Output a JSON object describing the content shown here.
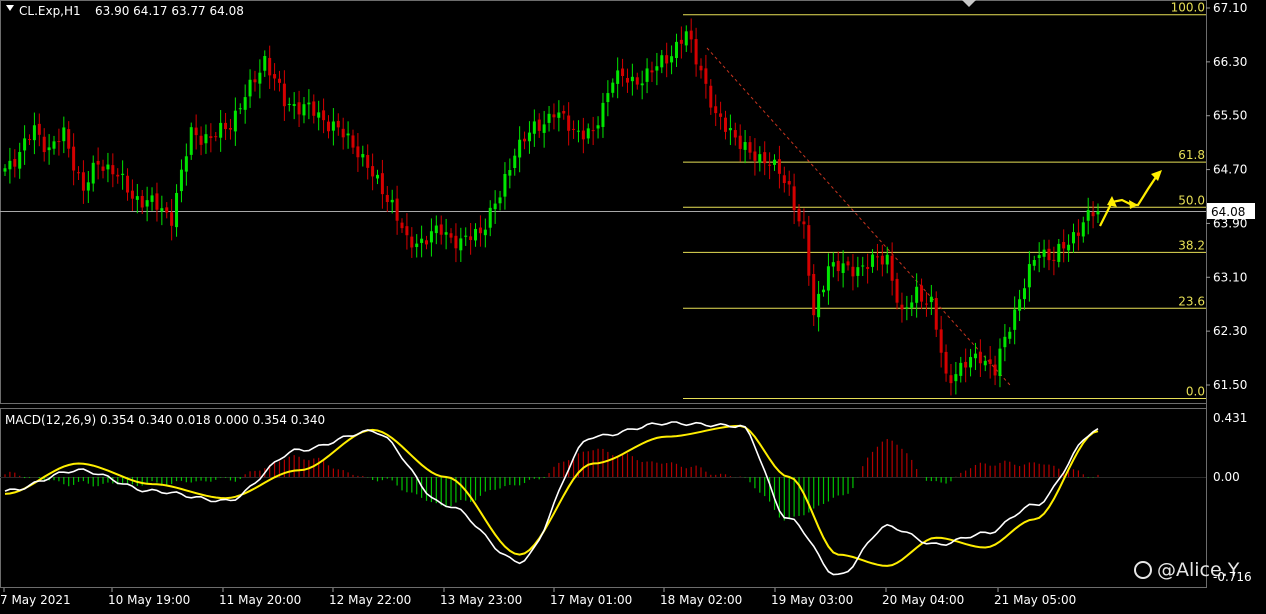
{
  "header": {
    "symbol_label": "CL.Exp,H1",
    "ohlc_label": "63.90 64.17 63.77 64.08"
  },
  "macd": {
    "label": "MACD(12,26,9) 0.354 0.340 0.018 0.000 0.354 0.340",
    "axis": [
      "0.431",
      "0.00",
      "-0.716"
    ]
  },
  "price_axis": [
    "67.10",
    "66.30",
    "65.50",
    "64.70",
    "63.90",
    "63.10",
    "62.30",
    "61.50"
  ],
  "current_price": "64.08",
  "fib_levels": [
    {
      "label": "100.0",
      "price": 67.0
    },
    {
      "label": "61.8",
      "price": 64.81
    },
    {
      "label": "50.0",
      "price": 64.14
    },
    {
      "label": "38.2",
      "price": 63.47
    },
    {
      "label": "23.6",
      "price": 62.64
    },
    {
      "label": "0.0",
      "price": 61.3
    }
  ],
  "time_axis": [
    "7 May 2021",
    "10 May 19:00",
    "11 May 20:00",
    "12 May 22:00",
    "13 May 23:00",
    "17 May 01:00",
    "18 May 02:00",
    "19 May 03:00",
    "20 May 04:00",
    "21 May 05:00"
  ],
  "watermark": "@Alice.Y",
  "colors": {
    "background": "#000000",
    "bull_candle": "#00e600",
    "bear_candle": "#d40000",
    "fib_line": "#e7df56",
    "macd_line": "#ffffff",
    "signal_line": "#ffee00",
    "arrow": "#ffee00",
    "trend_line": "#c8341f"
  },
  "chart_data": [
    {
      "type": "candlestick",
      "title": "CL.Exp,H1",
      "ylim": [
        61.27,
        67.18
      ],
      "close_key_points": [
        [
          0,
          64.72
        ],
        [
          3,
          64.95
        ],
        [
          6,
          65.3
        ],
        [
          9,
          65.0
        ],
        [
          12,
          65.22
        ],
        [
          16,
          64.4
        ],
        [
          19,
          64.8
        ],
        [
          22,
          64.7
        ],
        [
          26,
          64.3
        ],
        [
          30,
          64.2
        ],
        [
          34,
          64.0
        ],
        [
          38,
          65.25
        ],
        [
          42,
          65.15
        ],
        [
          46,
          65.4
        ],
        [
          50,
          65.9
        ],
        [
          53,
          66.35
        ],
        [
          57,
          65.7
        ],
        [
          62,
          65.6
        ],
        [
          67,
          65.35
        ],
        [
          72,
          65.0
        ],
        [
          75,
          64.6
        ],
        [
          79,
          64.2
        ],
        [
          82,
          63.6
        ],
        [
          85,
          63.65
        ],
        [
          89,
          63.8
        ],
        [
          93,
          63.6
        ],
        [
          97,
          63.8
        ],
        [
          101,
          64.3
        ],
        [
          104,
          65.0
        ],
        [
          108,
          65.3
        ],
        [
          112,
          65.55
        ],
        [
          116,
          65.3
        ],
        [
          120,
          65.2
        ],
        [
          124,
          66.1
        ],
        [
          128,
          66.0
        ],
        [
          132,
          66.15
        ],
        [
          136,
          66.45
        ],
        [
          139,
          66.7
        ],
        [
          142,
          66.2
        ],
        [
          145,
          65.45
        ],
        [
          148,
          65.3
        ],
        [
          152,
          64.9
        ],
        [
          156,
          64.85
        ],
        [
          160,
          64.4
        ],
        [
          163,
          63.8
        ],
        [
          165,
          62.5
        ],
        [
          168,
          63.3
        ],
        [
          172,
          63.2
        ],
        [
          176,
          63.3
        ],
        [
          180,
          63.4
        ],
        [
          183,
          62.5
        ],
        [
          186,
          62.9
        ],
        [
          189,
          62.7
        ],
        [
          192,
          61.6
        ],
        [
          196,
          61.8
        ],
        [
          199,
          61.95
        ],
        [
          202,
          61.7
        ],
        [
          205,
          62.4
        ],
        [
          208,
          63.0
        ],
        [
          211,
          63.5
        ],
        [
          214,
          63.4
        ],
        [
          217,
          63.6
        ],
        [
          220,
          63.95
        ],
        [
          223,
          64.08
        ]
      ]
    },
    {
      "type": "line",
      "title": "MACD(12,26,9)",
      "ylim": [
        -0.716,
        0.431
      ],
      "x": [
        0,
        15,
        30,
        45,
        60,
        75,
        90,
        105,
        120,
        135,
        150,
        160,
        170,
        180,
        190,
        200,
        210,
        223
      ],
      "series": [
        {
          "name": "MACD",
          "values": [
            -0.1,
            0.05,
            -0.1,
            -0.17,
            0.2,
            0.34,
            -0.2,
            -0.6,
            0.3,
            0.4,
            0.38,
            -0.3,
            -0.7,
            -0.35,
            -0.48,
            -0.4,
            -0.2,
            0.35
          ]
        },
        {
          "name": "Signal",
          "values": [
            -0.12,
            0.1,
            -0.05,
            -0.15,
            0.05,
            0.35,
            0.0,
            -0.55,
            0.1,
            0.3,
            0.38,
            0.0,
            -0.55,
            -0.63,
            -0.43,
            -0.5,
            -0.3,
            0.34
          ]
        }
      ]
    }
  ]
}
